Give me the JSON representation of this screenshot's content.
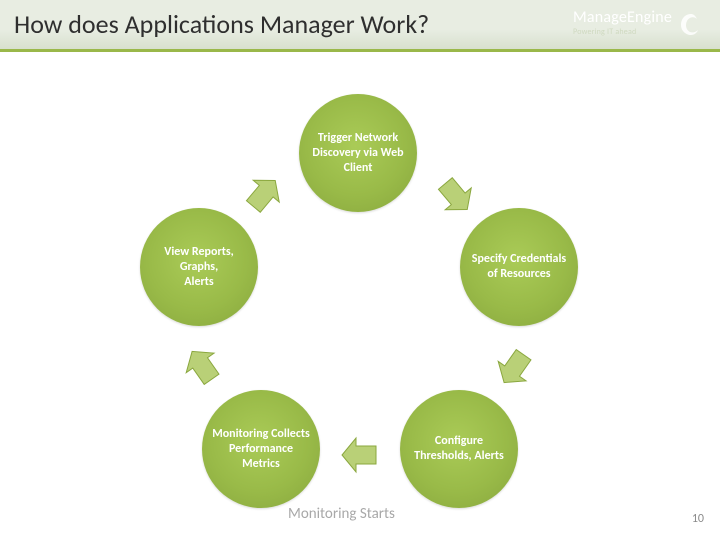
{
  "header": {
    "title": "How does Applications Manager Work?",
    "brand_main": "ManageEngine",
    "brand_sub": "Powering IT ahead"
  },
  "bubbles": {
    "b1": "Trigger Network Discovery via Web Client",
    "b2": "Specify Credentials of Resources",
    "b3": "Configure Thresholds, Alerts",
    "b4": "Monitoring Collects Performance Metrics",
    "b5": "View Reports, Graphs,\nAlerts"
  },
  "caption": "Monitoring Starts",
  "page_number": "10",
  "colors": {
    "accent": "#99ba48",
    "arrow_fill": "#b9d077",
    "arrow_stroke": "#8aa73e"
  }
}
